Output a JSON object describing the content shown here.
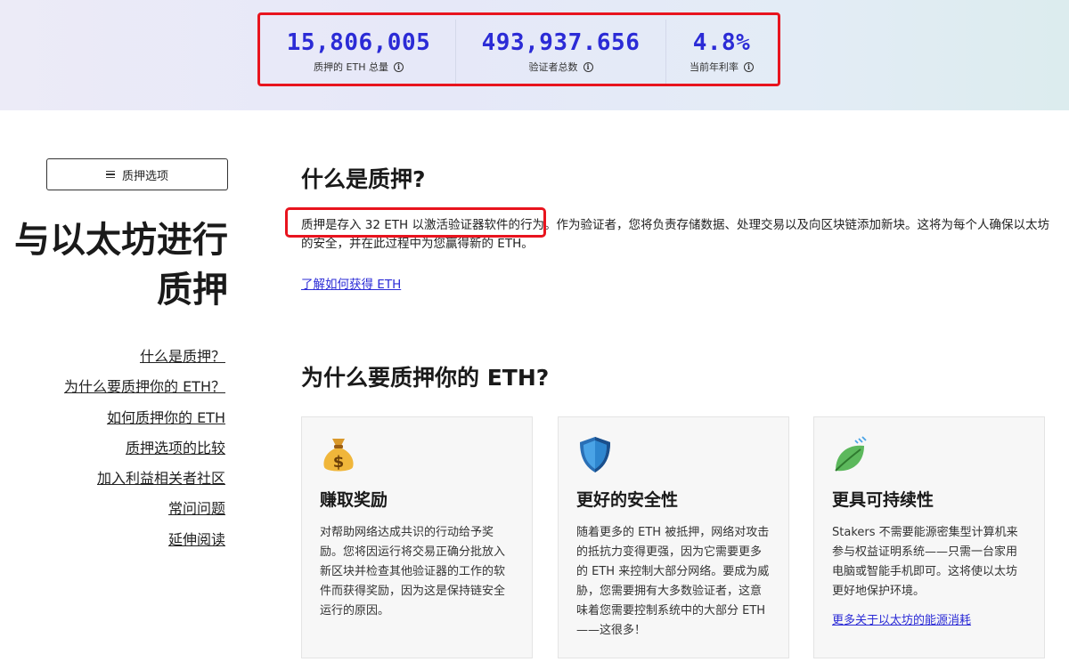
{
  "stats": [
    {
      "value": "15,806,005",
      "label": "质押的 ETH 总量"
    },
    {
      "value": "493,937.656",
      "label": "验证者总数"
    },
    {
      "value": "4.8%",
      "label": "当前年利率"
    }
  ],
  "sidebar": {
    "options_button": "质押选项",
    "title_line1": "与以太坊进行",
    "title_line2": "质押",
    "toc": [
      "什么是质押？",
      "为什么要质押你的 ETH？",
      "如何质押你的 ETH",
      "质押选项的比较",
      "加入利益相关者社区",
      "常问问题",
      "延伸阅读"
    ]
  },
  "main": {
    "what_heading": "什么是质押?",
    "intro_highlight": "质押是存入 32 ETH 以激活验证器软件的行为",
    "intro_rest": "。作为验证者，您将负责存储数据、处理交易以及向区块链添加新块。这将为每个人确保以太坊的安全，并在此过程中为您赢得新的 ETH。",
    "learn_link": "了解如何获得 ETH",
    "why_heading": "为什么要质押你的 ETH?"
  },
  "cards": [
    {
      "icon": "money-bag-icon",
      "title": "赚取奖励",
      "text": "对帮助网络达成共识的行动给予奖励。您将因运行将交易正确分批放入新区块并检查其他验证器的工作的软件而获得奖励，因为这是保持链安全运行的原因。"
    },
    {
      "icon": "shield-icon",
      "title": "更好的安全性",
      "text": "随着更多的 ETH 被抵押，网络对攻击的抵抗力变得更强，因为它需要更多的 ETH 来控制大部分网络。要成为威胁，您需要拥有大多数验证者，这意味着您需要控制系统中的大部分 ETH——这很多！"
    },
    {
      "icon": "leaf-icon",
      "title": "更具可持续性",
      "text": "Stakers 不需要能源密集型计算机来参与权益证明系统——只需一台家用电脑或智能手机即可。这将使以太坊更好地保护环境。",
      "link": "更多关于以太坊的能源消耗"
    }
  ],
  "colors": {
    "accent": "#2b2bd6",
    "highlight": "#e8141e"
  }
}
